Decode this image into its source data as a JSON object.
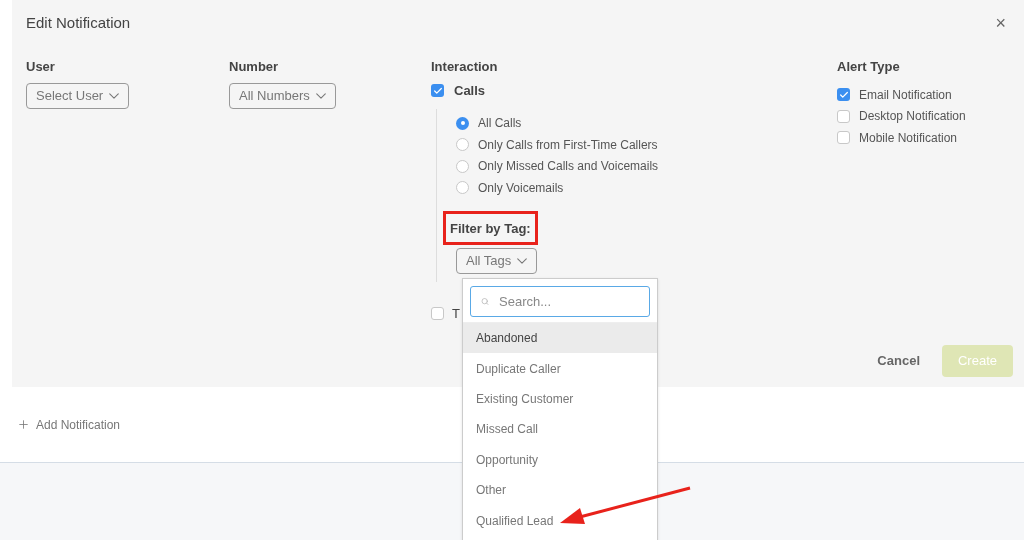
{
  "dialog": {
    "title": "Edit Notification",
    "close": "×"
  },
  "user": {
    "label": "User",
    "value": "Select User"
  },
  "number": {
    "label": "Number",
    "value": "All Numbers"
  },
  "interaction": {
    "label": "Interaction",
    "calls": {
      "label": "Calls",
      "checked": true
    },
    "options": [
      {
        "label": "All Calls",
        "selected": true
      },
      {
        "label": "Only Calls from First-Time Callers",
        "selected": false
      },
      {
        "label": "Only Missed Calls and Voicemails",
        "selected": false
      },
      {
        "label": "Only Voicemails",
        "selected": false
      }
    ],
    "filter_label": "Filter by Tag:",
    "filter_value": "All Tags",
    "second": {
      "label": "T",
      "checked": false
    }
  },
  "alert_type": {
    "label": "Alert Type",
    "items": [
      {
        "label": "Email Notification",
        "checked": true
      },
      {
        "label": "Desktop Notification",
        "checked": false
      },
      {
        "label": "Mobile Notification",
        "checked": false
      }
    ]
  },
  "buttons": {
    "cancel": "Cancel",
    "create": "Create",
    "create_disabled": true
  },
  "add_notification": "Add Notification",
  "tag_menu": {
    "placeholder": "Search...",
    "items": [
      {
        "label": "Abandoned",
        "highlighted": true
      },
      {
        "label": "Duplicate Caller",
        "highlighted": false
      },
      {
        "label": "Existing Customer",
        "highlighted": false
      },
      {
        "label": "Missed Call",
        "highlighted": false
      },
      {
        "label": "Opportunity",
        "highlighted": false
      },
      {
        "label": "Other",
        "highlighted": false
      },
      {
        "label": "Qualified Lead",
        "highlighted": false
      }
    ]
  }
}
